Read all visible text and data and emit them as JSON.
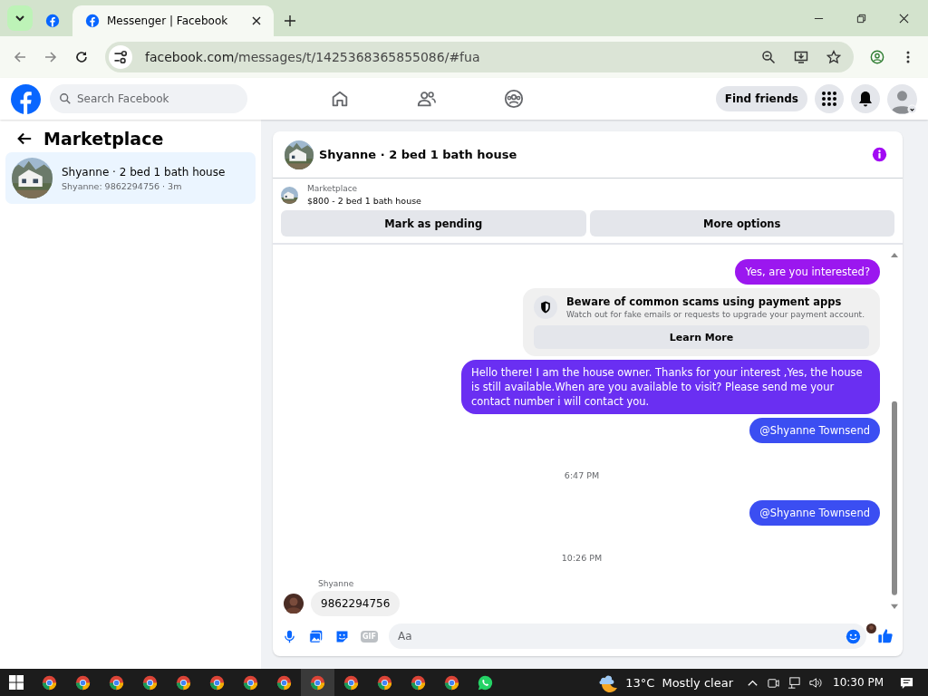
{
  "browser": {
    "tabs": [
      {
        "selected": false
      },
      {
        "title": "Messenger | Facebook",
        "selected": true
      }
    ],
    "address": {
      "host": "facebook.com",
      "path": "/messages/t/1425368365855086/#fua"
    }
  },
  "header": {
    "search": {
      "placeholder": "Search Facebook"
    },
    "find_friends": "Find friends"
  },
  "sidebar": {
    "title": "Marketplace",
    "conversations": [
      {
        "title": "Shyanne · 2 bed 1 bath house",
        "preview": "Shyanne: 9862294756 · 3m",
        "selected": true
      }
    ]
  },
  "chat": {
    "title": "Shyanne · 2 bed 1 bath house",
    "listing": {
      "label": "Marketplace",
      "item": "$800 - 2 bed 1 bath house"
    },
    "actions": [
      "Mark as pending",
      "More options"
    ],
    "messages": [
      {
        "kind": "out",
        "text": "Yes, are you interested?",
        "color": "#9b17ef"
      },
      {
        "kind": "notice",
        "title": "Beware of common scams using payment apps",
        "text": "Watch out for fake emails or requests to upgrade your payment account.",
        "button": "Learn More"
      },
      {
        "kind": "out",
        "text": "Hello there! I am the house owner. Thanks for your interest ,Yes, the house is still available.When are you available to visit? Please send me your contact number i will contact you.",
        "color": "#6a2ff2"
      },
      {
        "kind": "out",
        "text": "@Shyanne Townsend",
        "color": "#3b4ef2"
      },
      {
        "kind": "time",
        "text": "6:47 PM"
      },
      {
        "kind": "out",
        "text": "@Shyanne Townsend",
        "color": "#3b4ef2"
      },
      {
        "kind": "time",
        "text": "10:26 PM"
      },
      {
        "kind": "in",
        "sender": "Shyanne",
        "text": "9862294756"
      }
    ],
    "composer": {
      "gif": "GIF",
      "placeholder": "Aa"
    }
  },
  "taskbar": {
    "apps": [
      {
        "kind": "chrome",
        "selected": false
      },
      {
        "kind": "chrome",
        "selected": false
      },
      {
        "kind": "chrome",
        "selected": false
      },
      {
        "kind": "chrome",
        "selected": false
      },
      {
        "kind": "chrome",
        "selected": false
      },
      {
        "kind": "chrome",
        "selected": false
      },
      {
        "kind": "chrome",
        "selected": false
      },
      {
        "kind": "chrome",
        "selected": false
      },
      {
        "kind": "chrome",
        "selected": true
      },
      {
        "kind": "chrome",
        "selected": false
      },
      {
        "kind": "chrome",
        "selected": false
      },
      {
        "kind": "chrome",
        "selected": false
      },
      {
        "kind": "chrome",
        "selected": false
      },
      {
        "kind": "whatsapp",
        "selected": false
      }
    ],
    "weather": {
      "temp": "13°C",
      "condition": "Mostly clear"
    },
    "time": "10:30 PM"
  }
}
